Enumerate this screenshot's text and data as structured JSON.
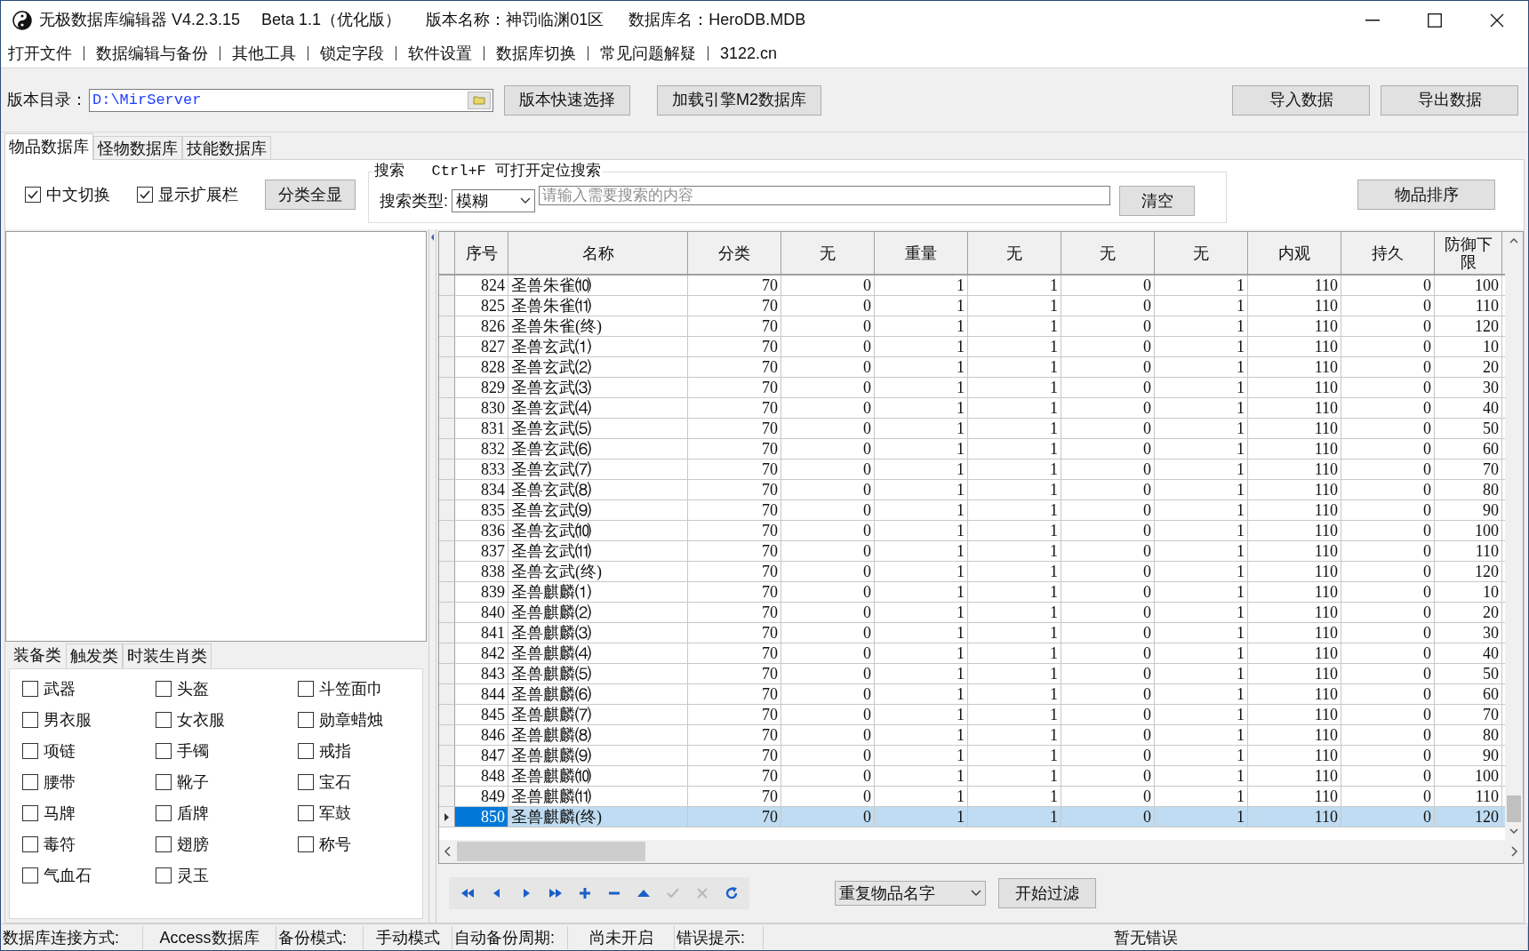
{
  "window": {
    "title_parts": [
      "无极数据库编辑器 V4.2.3.15",
      "Beta 1.1（优化版）",
      "版本名称：神罚临渊01区",
      "数据库名：HeroDB.MDB"
    ]
  },
  "menu": [
    "打开文件",
    "数据编辑与备份",
    "其他工具",
    "锁定字段",
    "软件设置",
    "数据库切换",
    "常见问题解疑",
    "3122.cn"
  ],
  "path_bar": {
    "label": "版本目录：",
    "value": "D:\\MirServer",
    "buttons": [
      "版本快速选择",
      "加载引擎M2数据库"
    ],
    "right_buttons": [
      "导入数据",
      "导出数据"
    ]
  },
  "tabs": [
    {
      "label": "物品数据库",
      "selected": true
    },
    {
      "label": "怪物数据库",
      "selected": false
    },
    {
      "label": "技能数据库",
      "selected": false
    }
  ],
  "options": {
    "checkboxes": [
      {
        "label": "中文切换",
        "checked": true
      },
      {
        "label": "显示扩展栏",
        "checked": true
      }
    ],
    "show_all_button": "分类全显",
    "search_title": "搜索   Ctrl+F 可打开定位搜索",
    "search_type_label": "搜索类型:",
    "search_type": "模糊",
    "search_placeholder": "请输入需要搜索的内容",
    "clear_button": "清空",
    "sort_button": "物品排序"
  },
  "category_tabs": [
    {
      "label": "装备类",
      "selected": true
    },
    {
      "label": "触发类",
      "selected": false
    },
    {
      "label": "时装生肖类",
      "selected": false
    }
  ],
  "categories": [
    {
      "label": "武器",
      "checked": false
    },
    {
      "label": "头盔",
      "checked": false
    },
    {
      "label": "斗笠面巾",
      "checked": false
    },
    {
      "label": "男衣服",
      "checked": false
    },
    {
      "label": "女衣服",
      "checked": false
    },
    {
      "label": "勋章蜡烛",
      "checked": false
    },
    {
      "label": "项链",
      "checked": false
    },
    {
      "label": "手镯",
      "checked": false
    },
    {
      "label": "戒指",
      "checked": false
    },
    {
      "label": "腰带",
      "checked": false
    },
    {
      "label": "靴子",
      "checked": false
    },
    {
      "label": "宝石",
      "checked": false
    },
    {
      "label": "马牌",
      "checked": false
    },
    {
      "label": "盾牌",
      "checked": false
    },
    {
      "label": "军鼓",
      "checked": false
    },
    {
      "label": "毒符",
      "checked": false
    },
    {
      "label": "翅膀",
      "checked": false
    },
    {
      "label": "称号",
      "checked": false
    },
    {
      "label": "气血石",
      "checked": false
    },
    {
      "label": "灵玉",
      "checked": false
    }
  ],
  "table": {
    "columns": [
      "序号",
      "名称",
      "分类",
      "无",
      "重量",
      "无",
      "无",
      "无",
      "内观",
      "持久",
      "防御下限"
    ],
    "rows": [
      {
        "cells": [
          "824",
          "圣兽朱雀⑽",
          "70",
          "0",
          "1",
          "1",
          "0",
          "1",
          "110",
          "0",
          "100"
        ],
        "selected": false
      },
      {
        "cells": [
          "825",
          "圣兽朱雀⑾",
          "70",
          "0",
          "1",
          "1",
          "0",
          "1",
          "110",
          "0",
          "110"
        ],
        "selected": false
      },
      {
        "cells": [
          "826",
          "圣兽朱雀(终)",
          "70",
          "0",
          "1",
          "1",
          "0",
          "1",
          "110",
          "0",
          "120"
        ],
        "selected": false
      },
      {
        "cells": [
          "827",
          "圣兽玄武⑴",
          "70",
          "0",
          "1",
          "1",
          "0",
          "1",
          "110",
          "0",
          "10"
        ],
        "selected": false
      },
      {
        "cells": [
          "828",
          "圣兽玄武⑵",
          "70",
          "0",
          "1",
          "1",
          "0",
          "1",
          "110",
          "0",
          "20"
        ],
        "selected": false
      },
      {
        "cells": [
          "829",
          "圣兽玄武⑶",
          "70",
          "0",
          "1",
          "1",
          "0",
          "1",
          "110",
          "0",
          "30"
        ],
        "selected": false
      },
      {
        "cells": [
          "830",
          "圣兽玄武⑷",
          "70",
          "0",
          "1",
          "1",
          "0",
          "1",
          "110",
          "0",
          "40"
        ],
        "selected": false
      },
      {
        "cells": [
          "831",
          "圣兽玄武⑸",
          "70",
          "0",
          "1",
          "1",
          "0",
          "1",
          "110",
          "0",
          "50"
        ],
        "selected": false
      },
      {
        "cells": [
          "832",
          "圣兽玄武⑹",
          "70",
          "0",
          "1",
          "1",
          "0",
          "1",
          "110",
          "0",
          "60"
        ],
        "selected": false
      },
      {
        "cells": [
          "833",
          "圣兽玄武⑺",
          "70",
          "0",
          "1",
          "1",
          "0",
          "1",
          "110",
          "0",
          "70"
        ],
        "selected": false
      },
      {
        "cells": [
          "834",
          "圣兽玄武⑻",
          "70",
          "0",
          "1",
          "1",
          "0",
          "1",
          "110",
          "0",
          "80"
        ],
        "selected": false
      },
      {
        "cells": [
          "835",
          "圣兽玄武⑼",
          "70",
          "0",
          "1",
          "1",
          "0",
          "1",
          "110",
          "0",
          "90"
        ],
        "selected": false
      },
      {
        "cells": [
          "836",
          "圣兽玄武⑽",
          "70",
          "0",
          "1",
          "1",
          "0",
          "1",
          "110",
          "0",
          "100"
        ],
        "selected": false
      },
      {
        "cells": [
          "837",
          "圣兽玄武⑾",
          "70",
          "0",
          "1",
          "1",
          "0",
          "1",
          "110",
          "0",
          "110"
        ],
        "selected": false
      },
      {
        "cells": [
          "838",
          "圣兽玄武(终)",
          "70",
          "0",
          "1",
          "1",
          "0",
          "1",
          "110",
          "0",
          "120"
        ],
        "selected": false
      },
      {
        "cells": [
          "839",
          "圣兽麒麟⑴",
          "70",
          "0",
          "1",
          "1",
          "0",
          "1",
          "110",
          "0",
          "10"
        ],
        "selected": false
      },
      {
        "cells": [
          "840",
          "圣兽麒麟⑵",
          "70",
          "0",
          "1",
          "1",
          "0",
          "1",
          "110",
          "0",
          "20"
        ],
        "selected": false
      },
      {
        "cells": [
          "841",
          "圣兽麒麟⑶",
          "70",
          "0",
          "1",
          "1",
          "0",
          "1",
          "110",
          "0",
          "30"
        ],
        "selected": false
      },
      {
        "cells": [
          "842",
          "圣兽麒麟⑷",
          "70",
          "0",
          "1",
          "1",
          "0",
          "1",
          "110",
          "0",
          "40"
        ],
        "selected": false
      },
      {
        "cells": [
          "843",
          "圣兽麒麟⑸",
          "70",
          "0",
          "1",
          "1",
          "0",
          "1",
          "110",
          "0",
          "50"
        ],
        "selected": false
      },
      {
        "cells": [
          "844",
          "圣兽麒麟⑹",
          "70",
          "0",
          "1",
          "1",
          "0",
          "1",
          "110",
          "0",
          "60"
        ],
        "selected": false
      },
      {
        "cells": [
          "845",
          "圣兽麒麟⑺",
          "70",
          "0",
          "1",
          "1",
          "0",
          "1",
          "110",
          "0",
          "70"
        ],
        "selected": false
      },
      {
        "cells": [
          "846",
          "圣兽麒麟⑻",
          "70",
          "0",
          "1",
          "1",
          "0",
          "1",
          "110",
          "0",
          "80"
        ],
        "selected": false
      },
      {
        "cells": [
          "847",
          "圣兽麒麟⑼",
          "70",
          "0",
          "1",
          "1",
          "0",
          "1",
          "110",
          "0",
          "90"
        ],
        "selected": false
      },
      {
        "cells": [
          "848",
          "圣兽麒麟⑽",
          "70",
          "0",
          "1",
          "1",
          "0",
          "1",
          "110",
          "0",
          "100"
        ],
        "selected": false
      },
      {
        "cells": [
          "849",
          "圣兽麒麟⑾",
          "70",
          "0",
          "1",
          "1",
          "0",
          "1",
          "110",
          "0",
          "110"
        ],
        "selected": false
      },
      {
        "cells": [
          "850",
          "圣兽麒麟(终)",
          "70",
          "0",
          "1",
          "1",
          "0",
          "1",
          "110",
          "0",
          "120"
        ],
        "selected": true
      }
    ]
  },
  "navigator": [
    {
      "kind": "first",
      "disabled": false
    },
    {
      "kind": "prior",
      "disabled": false
    },
    {
      "kind": "next",
      "disabled": false
    },
    {
      "kind": "last",
      "disabled": false
    },
    {
      "kind": "insert",
      "disabled": false
    },
    {
      "kind": "delete",
      "disabled": false
    },
    {
      "kind": "edit",
      "disabled": false
    },
    {
      "kind": "post",
      "disabled": true
    },
    {
      "kind": "cancel",
      "disabled": true
    },
    {
      "kind": "refresh",
      "disabled": false
    }
  ],
  "filter": {
    "mode": "重复物品名字",
    "button": "开始过滤"
  },
  "status_bar": [
    "数据库连接方式:",
    "Access数据库",
    "备份模式:",
    "手动模式",
    "自动备份周期:",
    "尚未开启",
    "错误提示:",
    "暂无错误"
  ]
}
